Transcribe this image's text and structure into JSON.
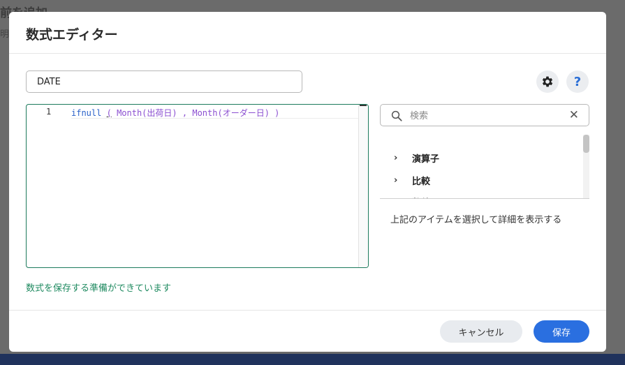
{
  "background": {
    "title": "前を追加",
    "subtitle": "明"
  },
  "dialog": {
    "title": "数式エディター",
    "name_value": "DATE",
    "editor": {
      "line_number": "1",
      "tokens": {
        "fn": "ifnull",
        "open": "(",
        "arg1": "Month(出荷日)",
        "comma": ",",
        "arg2": "Month(オーダー日)",
        "close": ")"
      }
    },
    "status": "数式を保存する準備ができています",
    "search": {
      "placeholder": "検索"
    },
    "tree": {
      "items": [
        {
          "label": "演算子"
        },
        {
          "label": "比較"
        },
        {
          "label": "数値"
        }
      ]
    },
    "detail_hint": "上記のアイテムを選択して詳細を表示する",
    "help_label": "?",
    "footer": {
      "cancel_label": "キャンセル",
      "save_label": "保存"
    }
  },
  "colors": {
    "accent": "#2a6fe0",
    "editor_border": "#1c7a5c",
    "status": "#1f8a60",
    "function": "#2b62c9",
    "field": "#8b4fd1"
  },
  "icons": [
    "gear-icon",
    "help-icon",
    "search-icon",
    "close-icon",
    "chevron-right-icon"
  ]
}
